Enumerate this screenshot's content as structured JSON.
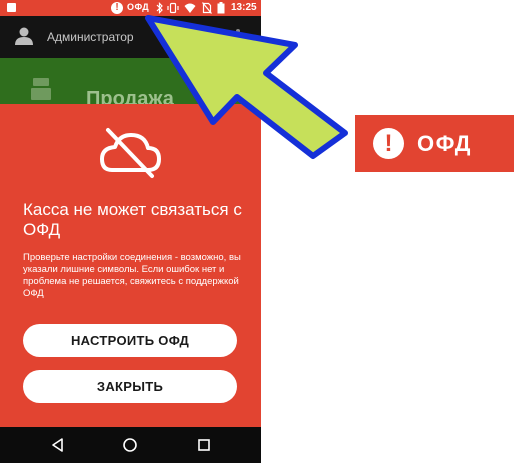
{
  "status_bar": {
    "ofd_indicator": "ОФД",
    "warning_glyph": "!",
    "time": "13:25",
    "icons": [
      "notification-square-icon",
      "warning-circle-icon",
      "bluetooth-icon",
      "vibrate-icon",
      "wifi-icon",
      "no-sim-icon",
      "battery-icon"
    ]
  },
  "app_bar": {
    "user_name": "Администратор",
    "icons": [
      "user-icon",
      "more-icon"
    ]
  },
  "background_screen": {
    "title": "Продажа",
    "icon": "cash-register-icon",
    "color": "#2f6e1d"
  },
  "dialog": {
    "icon": "cloud-off-icon",
    "title": "Касса не может связаться с ОФД",
    "description": "Проверьте настройки соединения - возможно, вы указали лишние символы. Если ошибок нет и проблема не решается, свяжитесь с поддержкой ОФД",
    "primary_button": "НАСТРОИТЬ ОФД",
    "secondary_button": "ЗАКРЫТЬ"
  },
  "nav_bar": {
    "icons": [
      "back-icon",
      "home-icon",
      "recents-icon"
    ]
  },
  "callout": {
    "warning_glyph": "!",
    "label": "ОФД",
    "arrow_color": "#c6e05a",
    "arrow_outline_color": "#1530d8"
  },
  "colors": {
    "error_red": "#e24431",
    "app_bar_dark": "#141414",
    "button_bg": "#ffffff"
  }
}
